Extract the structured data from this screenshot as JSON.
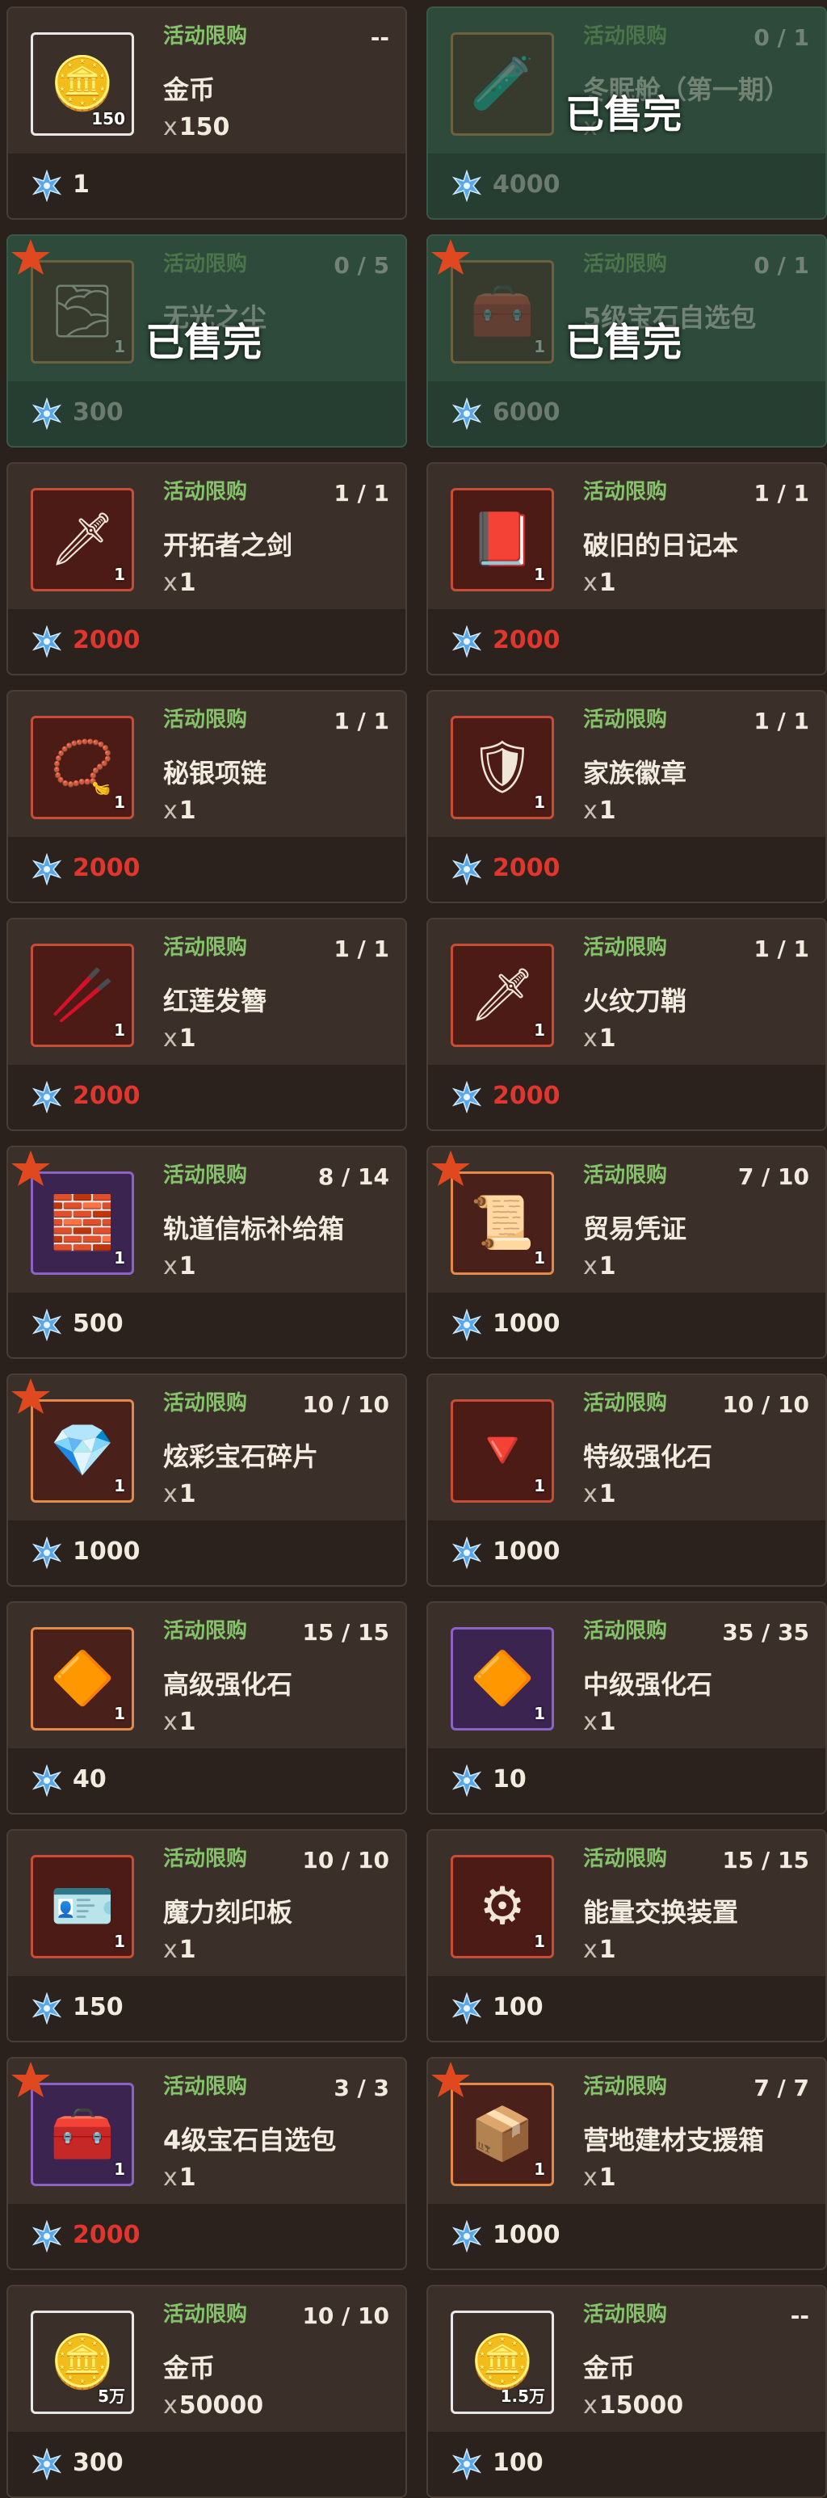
{
  "shop": {
    "sold_out_label": "已售完",
    "tag_label": "活动限购",
    "price_icon": "snowflake-gem-icon",
    "colors": {
      "tag": "#84c36a",
      "price_red": "#e0362d",
      "badge_star": "#e0491f",
      "sold_bg": "#2d4a3a"
    },
    "items": [
      {
        "name": "金币",
        "x": "x",
        "qty": "150",
        "badge": "150",
        "counter": "--",
        "price": "1",
        "icon": "gold-coin-icon",
        "rarity": "white",
        "sold_out": false,
        "star": false,
        "price_red": false
      },
      {
        "name": "冬眠舱（第一期）",
        "x": "x",
        "qty": "",
        "badge": "",
        "counter": "0 / 1",
        "price": "4000",
        "icon": "hibernation-pod-icon",
        "rarity": "orange",
        "sold_out": true,
        "star": false,
        "price_red": false
      },
      {
        "name": "无光之尘",
        "x": "",
        "qty": "",
        "badge": "1",
        "counter": "0 / 5",
        "price": "300",
        "icon": "dust-icon",
        "rarity": "orange",
        "sold_out": true,
        "star": true,
        "price_red": false
      },
      {
        "name": "5级宝石自选包",
        "x": "",
        "qty": "",
        "badge": "1",
        "counter": "0 / 1",
        "price": "6000",
        "icon": "gem-chest-icon",
        "rarity": "orange",
        "sold_out": true,
        "star": true,
        "price_red": false
      },
      {
        "name": "开拓者之剑",
        "x": "x",
        "qty": "1",
        "badge": "1",
        "counter": "1 / 1",
        "price": "2000",
        "icon": "sword-icon",
        "rarity": "red",
        "sold_out": false,
        "star": false,
        "price_red": true
      },
      {
        "name": "破旧的日记本",
        "x": "x",
        "qty": "1",
        "badge": "1",
        "counter": "1 / 1",
        "price": "2000",
        "icon": "diary-icon",
        "rarity": "red",
        "sold_out": false,
        "star": false,
        "price_red": true
      },
      {
        "name": "秘银项链",
        "x": "x",
        "qty": "1",
        "badge": "1",
        "counter": "1 / 1",
        "price": "2000",
        "icon": "necklace-icon",
        "rarity": "red",
        "sold_out": false,
        "star": false,
        "price_red": true
      },
      {
        "name": "家族徽章",
        "x": "x",
        "qty": "1",
        "badge": "1",
        "counter": "1 / 1",
        "price": "2000",
        "icon": "emblem-icon",
        "rarity": "red",
        "sold_out": false,
        "star": false,
        "price_red": true
      },
      {
        "name": "红莲发簪",
        "x": "x",
        "qty": "1",
        "badge": "1",
        "counter": "1 / 1",
        "price": "2000",
        "icon": "hairpin-icon",
        "rarity": "red",
        "sold_out": false,
        "star": false,
        "price_red": true
      },
      {
        "name": "火纹刀鞘",
        "x": "x",
        "qty": "1",
        "badge": "1",
        "counter": "1 / 1",
        "price": "2000",
        "icon": "scabbard-icon",
        "rarity": "red",
        "sold_out": false,
        "star": false,
        "price_red": true
      },
      {
        "name": "轨道信标补给箱",
        "x": "x",
        "qty": "1",
        "badge": "1",
        "counter": "8 / 14",
        "price": "500",
        "icon": "beacon-crate-icon",
        "rarity": "purple",
        "sold_out": false,
        "star": true,
        "price_red": false
      },
      {
        "name": "贸易凭证",
        "x": "x",
        "qty": "1",
        "badge": "1",
        "counter": "7 / 10",
        "price": "1000",
        "icon": "trade-voucher-icon",
        "rarity": "orange",
        "sold_out": false,
        "star": true,
        "price_red": false
      },
      {
        "name": "炫彩宝石碎片",
        "x": "x",
        "qty": "1",
        "badge": "1",
        "counter": "10 / 10",
        "price": "1000",
        "icon": "gem-shards-icon",
        "rarity": "orange",
        "sold_out": false,
        "star": true,
        "price_red": false
      },
      {
        "name": "特级强化石",
        "x": "x",
        "qty": "1",
        "badge": "1",
        "counter": "10 / 10",
        "price": "1000",
        "icon": "red-crystal-icon",
        "rarity": "red",
        "sold_out": false,
        "star": false,
        "price_red": false
      },
      {
        "name": "高级强化石",
        "x": "x",
        "qty": "1",
        "badge": "1",
        "counter": "15 / 15",
        "price": "40",
        "icon": "orange-crystal-icon",
        "rarity": "orange",
        "sold_out": false,
        "star": false,
        "price_red": false
      },
      {
        "name": "中级强化石",
        "x": "x",
        "qty": "1",
        "badge": "1",
        "counter": "35 / 35",
        "price": "10",
        "icon": "orange-crystal-icon",
        "rarity": "purple",
        "sold_out": false,
        "star": false,
        "price_red": false
      },
      {
        "name": "魔力刻印板",
        "x": "x",
        "qty": "1",
        "badge": "1",
        "counter": "10 / 10",
        "price": "150",
        "icon": "engraving-plate-icon",
        "rarity": "red",
        "sold_out": false,
        "star": false,
        "price_red": false
      },
      {
        "name": "能量交换装置",
        "x": "x",
        "qty": "1",
        "badge": "1",
        "counter": "15 / 15",
        "price": "100",
        "icon": "energy-device-icon",
        "rarity": "red",
        "sold_out": false,
        "star": false,
        "price_red": false
      },
      {
        "name": "4级宝石自选包",
        "x": "x",
        "qty": "1",
        "badge": "1",
        "counter": "3 / 3",
        "price": "2000",
        "icon": "gem-chest-icon",
        "rarity": "purple",
        "sold_out": false,
        "star": true,
        "price_red": true
      },
      {
        "name": "营地建材支援箱",
        "x": "x",
        "qty": "1",
        "badge": "1",
        "counter": "7 / 7",
        "price": "1000",
        "icon": "material-crate-icon",
        "rarity": "orange",
        "sold_out": false,
        "star": true,
        "price_red": false
      },
      {
        "name": "金币",
        "x": "x",
        "qty": "50000",
        "badge": "5万",
        "counter": "10 / 10",
        "price": "300",
        "icon": "gold-coin-icon",
        "rarity": "white",
        "sold_out": false,
        "star": false,
        "price_red": false
      },
      {
        "name": "金币",
        "x": "x",
        "qty": "15000",
        "badge": "1.5万",
        "counter": "--",
        "price": "100",
        "icon": "gold-coin-icon",
        "rarity": "white",
        "sold_out": false,
        "star": false,
        "price_red": false
      }
    ]
  }
}
